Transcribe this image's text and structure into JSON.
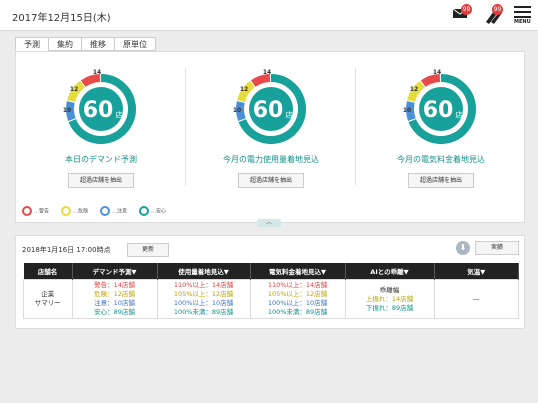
{
  "header": {
    "date": "2017年12月15日(木)",
    "mail_badge": "99",
    "alert_badge": "99",
    "menu_label": "MENU"
  },
  "tabs": [
    "予測",
    "集約",
    "推移",
    "原単位"
  ],
  "gauges": [
    {
      "center_value": "60",
      "unit": "店",
      "label": "本日のデマンド予測",
      "button": "超過店舗を抽出",
      "segments": {
        "red": "14",
        "yellow": "12",
        "blue": "10"
      }
    },
    {
      "center_value": "60",
      "unit": "店",
      "label": "今月の電力使用量着地見込",
      "button": "超過店舗を抽出",
      "segments": {
        "red": "14",
        "yellow": "12",
        "blue": "10"
      }
    },
    {
      "center_value": "60",
      "unit": "店",
      "label": "今月の電気料金着地見込",
      "button": "超過店舗を抽出",
      "segments": {
        "red": "14",
        "yellow": "12",
        "blue": "10"
      }
    }
  ],
  "legend": [
    "…警告",
    "…危険",
    "…注意",
    "…安心"
  ],
  "colors": {
    "red": "#e84a4a",
    "yellow": "#e6dc3c",
    "blue": "#4a90d9",
    "teal": "#17a19a"
  },
  "summary": {
    "as_of": "2018年1月16日 17:00時点",
    "update_button": "更新",
    "exec_button": "実績",
    "columns": [
      "店舗名",
      "デマンド予測▼",
      "使用量着地見込▼",
      "電気料金着地見込▼",
      "AIとの乖離▼",
      "気温▼"
    ],
    "row": {
      "store": [
        "企業",
        "サマリー"
      ],
      "demand": [
        "警告：14店舗",
        "危険：12店舗",
        "注意：10店舗",
        "安心：89店舗"
      ],
      "usage": [
        "110%以上：14店舗",
        "105%以上：12店舗",
        "100%以上：10店舗",
        "100%未満：89店舗"
      ],
      "cost": [
        "110%以上：14店舗",
        "105%以上：12店舗",
        "100%以上：10店舗",
        "100%未満：89店舗"
      ],
      "ai": [
        "乖離幅",
        "上振れ：14店舗",
        "下振れ：89店舗"
      ],
      "temp": "―"
    }
  }
}
